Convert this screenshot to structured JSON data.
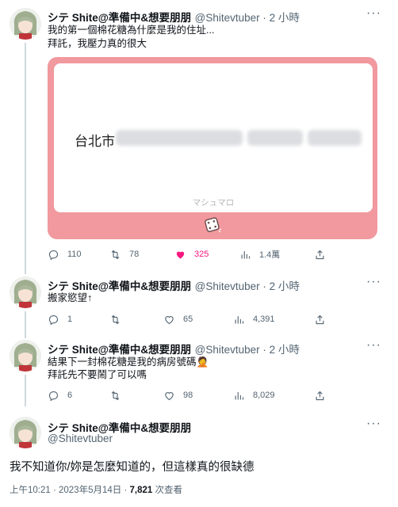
{
  "author": {
    "display_name": "シテ Shite@準備中&想要朋朋",
    "handle": "@Shitevtuber"
  },
  "tweets": [
    {
      "meta": "@Shitevtuber · 2 小時",
      "lines": [
        "我的第一個棉花糖為什麼是我的住址...",
        "拜託，我壓力真的很大"
      ],
      "card": {
        "address_prefix": "台北市",
        "brand": "マシュマロ",
        "dice_icon": "dice-icon"
      },
      "stats": {
        "replies": "110",
        "retweets": "78",
        "likes": "325",
        "views": "1.4萬"
      }
    },
    {
      "meta": "@Shitevtuber · 2 小時",
      "lines": [
        "搬家慾望↑"
      ],
      "stats": {
        "replies": "1",
        "retweets": "",
        "likes": "65",
        "views": "4,391"
      }
    },
    {
      "meta": "@Shitevtuber · 2 小時",
      "lines": [
        "結果下一封棉花糖是我的病房號碼🤦",
        "拜託先不要鬧了可以嗎"
      ],
      "stats": {
        "replies": "6",
        "retweets": "",
        "likes": "98",
        "views": "8,029"
      }
    }
  ],
  "main_tweet": {
    "text": "我不知道你/妳是怎麼知道的，但這樣真的很缺德",
    "timestamp": "上午10:21 · 2023年5月14日 · ",
    "views_count": "7,821",
    "views_label": " 次查看"
  },
  "colors": {
    "like_active": "#f91880",
    "secondary": "#536471",
    "card_pink": "#f1999e"
  }
}
